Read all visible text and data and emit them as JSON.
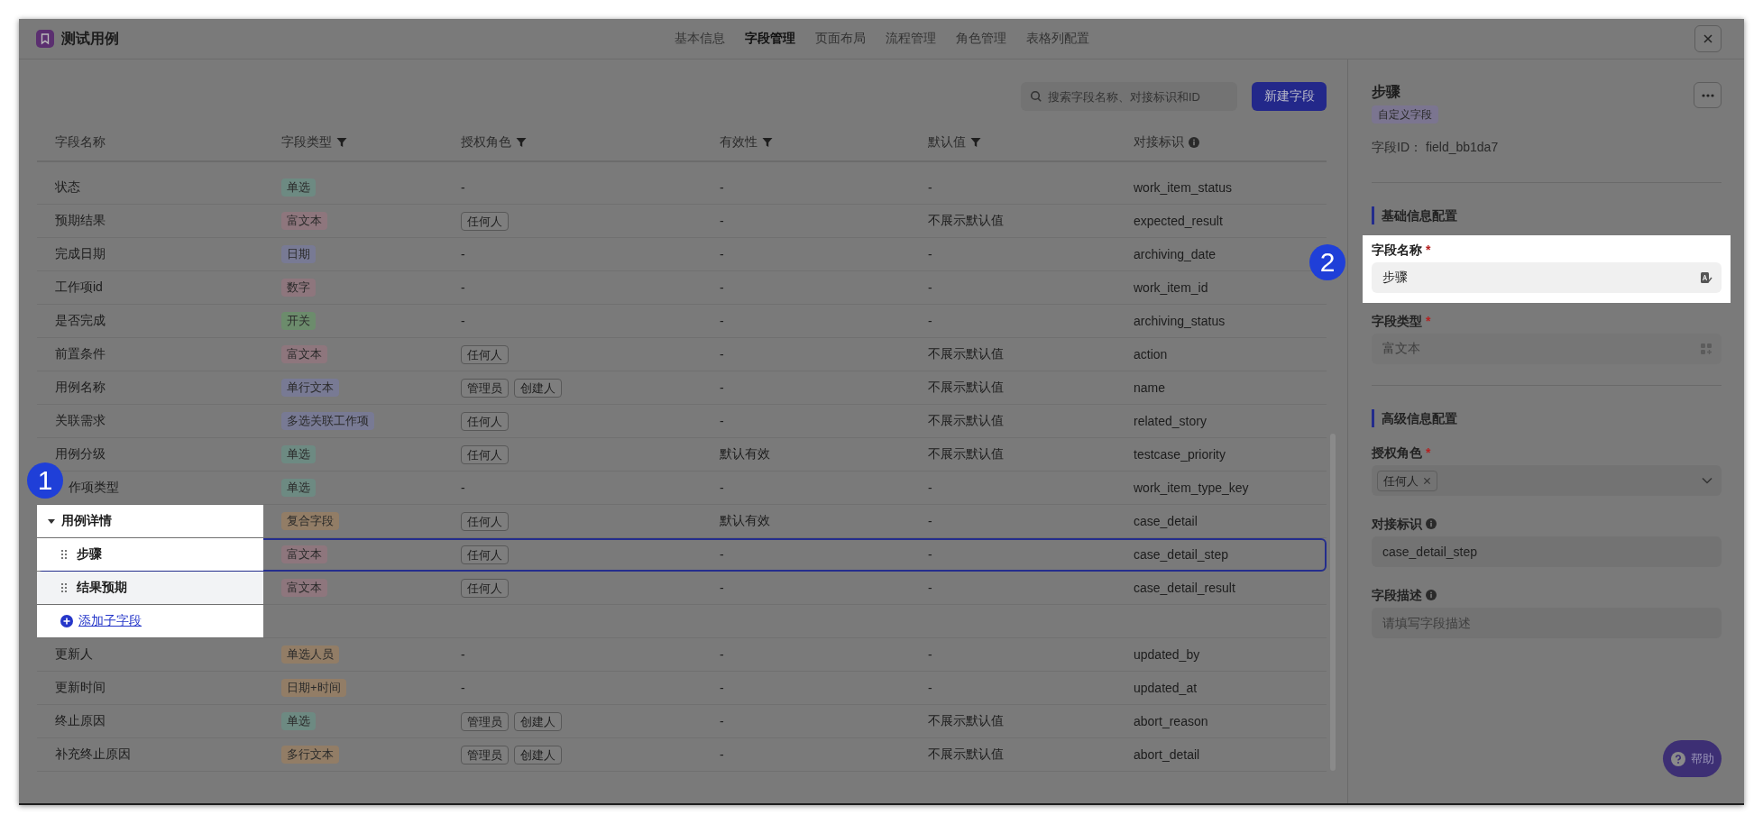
{
  "window": {
    "title": "测试用例"
  },
  "tabs": [
    {
      "label": "基本信息",
      "selected": false
    },
    {
      "label": "字段管理",
      "selected": true
    },
    {
      "label": "页面布局",
      "selected": false
    },
    {
      "label": "流程管理",
      "selected": false
    },
    {
      "label": "角色管理",
      "selected": false
    },
    {
      "label": "表格列配置",
      "selected": false
    }
  ],
  "toolbar": {
    "search": {
      "placeholder": "搜索字段名称、对接标识和ID"
    },
    "new_button": "新建字段"
  },
  "table": {
    "columns": [
      {
        "label": "字段名称"
      },
      {
        "label": "字段类型",
        "filter": true
      },
      {
        "label": "授权角色",
        "filter": true
      },
      {
        "label": "有效性",
        "filter": true
      },
      {
        "label": "默认值",
        "filter": true
      },
      {
        "label": "对接标识",
        "info": true
      }
    ],
    "rows": [
      {
        "kind": "field",
        "selected": false,
        "name": "状态",
        "type": {
          "label": "单选",
          "color": "#6d8a82"
        },
        "roles": "-",
        "validity": "-",
        "default": "-",
        "key": "work_item_status"
      },
      {
        "kind": "field",
        "selected": false,
        "name": "预期结果",
        "type": {
          "label": "富文本",
          "color": "#8e767d"
        },
        "roles": [
          "任何人"
        ],
        "validity": "-",
        "default": "不展示默认值",
        "key": "expected_result"
      },
      {
        "kind": "field",
        "selected": false,
        "name": "完成日期",
        "type": {
          "label": "日期",
          "color": "#787a94"
        },
        "roles": "-",
        "validity": "-",
        "default": "-",
        "key": "archiving_date"
      },
      {
        "kind": "field",
        "selected": false,
        "name": "工作项id",
        "type": {
          "label": "数字",
          "color": "#8e767d"
        },
        "roles": "-",
        "validity": "-",
        "default": "-",
        "key": "work_item_id"
      },
      {
        "kind": "field",
        "selected": false,
        "name": "是否完成",
        "type": {
          "label": "开关",
          "color": "#6c8c6c"
        },
        "roles": "-",
        "validity": "-",
        "default": "-",
        "key": "archiving_status"
      },
      {
        "kind": "field",
        "selected": false,
        "name": "前置条件",
        "type": {
          "label": "富文本",
          "color": "#8e767d"
        },
        "roles": [
          "任何人"
        ],
        "validity": "-",
        "default": "不展示默认值",
        "key": "action"
      },
      {
        "kind": "field",
        "selected": false,
        "name": "用例名称",
        "type": {
          "label": "单行文本",
          "color": "#787a94"
        },
        "roles": [
          "管理员",
          "创建人"
        ],
        "validity": "-",
        "default": "不展示默认值",
        "key": "name"
      },
      {
        "kind": "field",
        "selected": false,
        "name": "关联需求",
        "type": {
          "label": "多选关联工作项",
          "color": "#787a94"
        },
        "roles": [
          "任何人"
        ],
        "validity": "-",
        "default": "不展示默认值",
        "key": "related_story"
      },
      {
        "kind": "field",
        "selected": false,
        "name": "用例分级",
        "type": {
          "label": "单选",
          "color": "#6d8a82"
        },
        "roles": [
          "任何人"
        ],
        "validity": "默认有效",
        "default": "不展示默认值",
        "key": "testcase_priority"
      },
      {
        "kind": "field",
        "selected": false,
        "callout": "1",
        "name": "作项类型",
        "type": {
          "label": "单选",
          "color": "#6d8a82"
        },
        "roles": "-",
        "validity": "-",
        "default": "-",
        "key": "work_item_type_key"
      },
      {
        "kind": "group",
        "selected": false,
        "expanded": true,
        "spotlit": true,
        "name": "用例详情",
        "type": {
          "label": "复合字段",
          "color": "#927d66"
        },
        "roles": [
          "任何人"
        ],
        "validity": "默认有效",
        "default": "-",
        "key": "case_detail",
        "children": [
          {
            "kind": "child",
            "selected": true,
            "name": "步骤",
            "type": {
              "label": "富文本",
              "color": "#8e767d"
            },
            "roles": [
              "任何人"
            ],
            "validity": "-",
            "default": "-",
            "key": "case_detail_step"
          },
          {
            "kind": "child",
            "selected": false,
            "name": "结果预期",
            "type": {
              "label": "富文本",
              "color": "#8e767d"
            },
            "roles": [
              "任何人"
            ],
            "validity": "-",
            "default": "-",
            "key": "case_detail_result"
          }
        ],
        "add_child": "添加子字段"
      },
      {
        "kind": "field",
        "selected": false,
        "name": "更新人",
        "type": {
          "label": "单选人员",
          "color": "#927d66"
        },
        "roles": "-",
        "validity": "-",
        "default": "-",
        "key": "updated_by"
      },
      {
        "kind": "field",
        "selected": false,
        "name": "更新时间",
        "type": {
          "label": "日期+时间",
          "color": "#927d66"
        },
        "roles": "-",
        "validity": "-",
        "default": "-",
        "key": "updated_at"
      },
      {
        "kind": "field",
        "selected": false,
        "name": "终止原因",
        "type": {
          "label": "单选",
          "color": "#6d8a82"
        },
        "roles": [
          "管理员",
          "创建人"
        ],
        "validity": "-",
        "default": "不展示默认值",
        "key": "abort_reason"
      },
      {
        "kind": "field",
        "selected": false,
        "name": "补充终止原因",
        "type": {
          "label": "多行文本",
          "color": "#927d66"
        },
        "roles": [
          "管理员",
          "创建人"
        ],
        "validity": "-",
        "default": "不展示默认值",
        "key": "abort_detail"
      }
    ]
  },
  "detail": {
    "title": "步骤",
    "tag": "自定义字段",
    "id_label": "字段ID：",
    "id_value": "field_bb1da7",
    "sections": [
      {
        "title": "基础信息配置",
        "fields": [
          {
            "kind": "translatable",
            "label": "字段名称",
            "required_mark": "*",
            "spotlit": true,
            "callout": "2",
            "value": "步骤"
          },
          {
            "kind": "select",
            "label": "字段类型",
            "required_mark": "*",
            "disabled": true,
            "value": "富文本"
          }
        ]
      },
      {
        "title": "高级信息配置",
        "fields": [
          {
            "kind": "tags",
            "label": "授权角色",
            "required_mark": "*",
            "tags": [
              "任何人"
            ]
          },
          {
            "kind": "text",
            "label": "对接标识",
            "info": true,
            "value": "case_detail_step"
          },
          {
            "kind": "text",
            "label": "字段描述",
            "info": true,
            "placeholder": "请填写字段描述"
          }
        ]
      }
    ]
  },
  "help_button": "帮助"
}
